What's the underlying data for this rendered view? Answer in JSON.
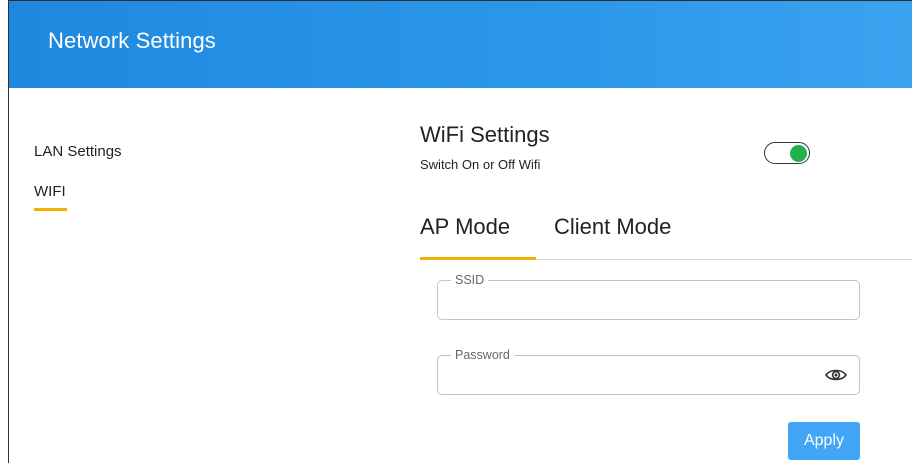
{
  "header": {
    "title": "Network Settings"
  },
  "sidebar": {
    "items": [
      {
        "label": "LAN Settings"
      },
      {
        "label": "WIFI",
        "active": true
      }
    ]
  },
  "wifi": {
    "title": "WiFi Settings",
    "subtitle": "Switch On or Off Wifi",
    "enabled": true,
    "toggle_color": "#22b14c"
  },
  "tabs": [
    {
      "label": "AP Mode",
      "active": true
    },
    {
      "label": "Client Mode",
      "active": false
    }
  ],
  "form": {
    "ssid": {
      "label": "SSID",
      "value": ""
    },
    "password": {
      "label": "Password",
      "value": "",
      "icon": "eye-icon"
    },
    "apply_label": "Apply"
  },
  "colors": {
    "header": "#2b97ea",
    "accent_underline": "#f0b400",
    "apply_button": "#42a5f5"
  }
}
